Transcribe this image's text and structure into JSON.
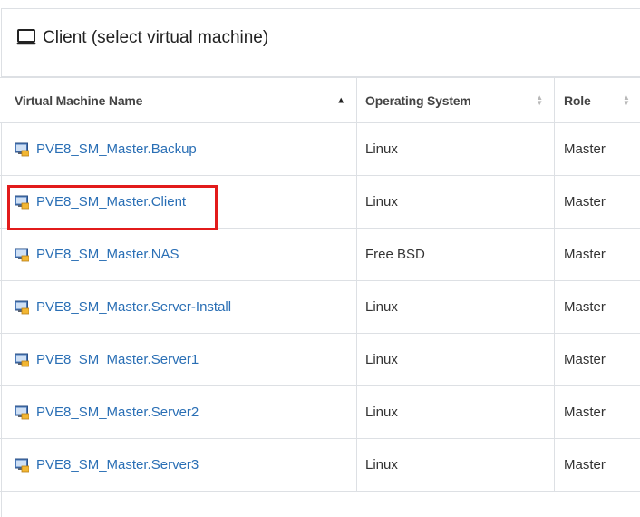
{
  "panel": {
    "title": "Client (select virtual machine)",
    "icon": "monitor-icon"
  },
  "table": {
    "columns": [
      {
        "label": "Virtual Machine Name",
        "sort": "ascending"
      },
      {
        "label": "Operating System",
        "sort": "none"
      },
      {
        "label": "Role",
        "sort": "none"
      }
    ],
    "rows": [
      {
        "name": "PVE8_SM_Master.Backup",
        "os": "Linux",
        "role": "Master"
      },
      {
        "name": "PVE8_SM_Master.Client",
        "os": "Linux",
        "role": "Master",
        "highlighted": true
      },
      {
        "name": "PVE8_SM_Master.NAS",
        "os": "Free BSD",
        "role": "Master"
      },
      {
        "name": "PVE8_SM_Master.Server-Install",
        "os": "Linux",
        "role": "Master"
      },
      {
        "name": "PVE8_SM_Master.Server1",
        "os": "Linux",
        "role": "Master"
      },
      {
        "name": "PVE8_SM_Master.Server2",
        "os": "Linux",
        "role": "Master"
      },
      {
        "name": "PVE8_SM_Master.Server3",
        "os": "Linux",
        "role": "Master"
      }
    ]
  },
  "colors": {
    "link": "#2a6fb5",
    "highlight": "#e21b1b",
    "border": "#dde0e4"
  }
}
